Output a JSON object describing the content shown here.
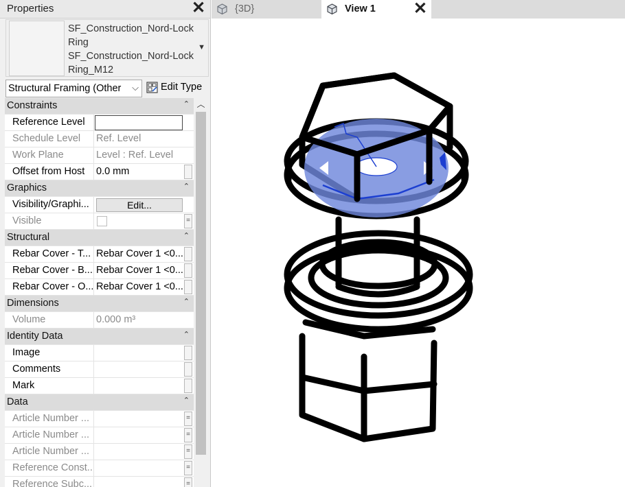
{
  "properties": {
    "title": "Properties",
    "type_selector": {
      "line1": "SF_Construction_Nord-Lock",
      "line2": "Ring",
      "line3": "SF_Construction_Nord-Lock",
      "line4": "Ring_M12"
    },
    "filter": "Structural Framing (Other",
    "edit_type": "Edit Type",
    "groups": {
      "constraints": {
        "label": "Constraints",
        "reference_level": {
          "key": "Reference Level",
          "value": ""
        },
        "schedule_level": {
          "key": "Schedule Level",
          "value": "Ref. Level"
        },
        "work_plane": {
          "key": "Work Plane",
          "value": "Level : Ref. Level"
        },
        "offset_from_host": {
          "key": "Offset from Host",
          "value": "0.0 mm"
        }
      },
      "graphics": {
        "label": "Graphics",
        "visibility": {
          "key": "Visibility/Graphi...",
          "button": "Edit..."
        },
        "visible": {
          "key": "Visible",
          "checked": false
        }
      },
      "structural": {
        "label": "Structural",
        "rebar_top": {
          "key": "Rebar Cover - T...",
          "value": "Rebar Cover 1 <0..."
        },
        "rebar_bottom": {
          "key": "Rebar Cover - B...",
          "value": "Rebar Cover 1 <0..."
        },
        "rebar_other": {
          "key": "Rebar Cover - O...",
          "value": "Rebar Cover 1 <0..."
        }
      },
      "dimensions": {
        "label": "Dimensions",
        "volume": {
          "key": "Volume",
          "value": "0.000 m³"
        }
      },
      "identity": {
        "label": "Identity Data",
        "image": {
          "key": "Image",
          "value": ""
        },
        "comments": {
          "key": "Comments",
          "value": ""
        },
        "mark": {
          "key": "Mark",
          "value": ""
        }
      },
      "data": {
        "label": "Data",
        "article1": {
          "key": "Article Number ...",
          "value": ""
        },
        "article2": {
          "key": "Article Number ...",
          "value": ""
        },
        "article3": {
          "key": "Article Number ...",
          "value": ""
        },
        "ref_const": {
          "key": "Reference Const...",
          "value": ""
        },
        "ref_subc": {
          "key": "Reference Subc...",
          "value": ""
        }
      }
    }
  },
  "tabs": {
    "tab_3d": "{3D}",
    "tab_view1": "View 1"
  },
  "icons": {
    "close": "close-icon",
    "collapse": "double-chevron-up-icon",
    "view3d": "3d-view-cube-icon"
  },
  "colors": {
    "selection": "#6f88dc",
    "selection_lines": "#1c3fd1",
    "model_lines": "#000000"
  }
}
